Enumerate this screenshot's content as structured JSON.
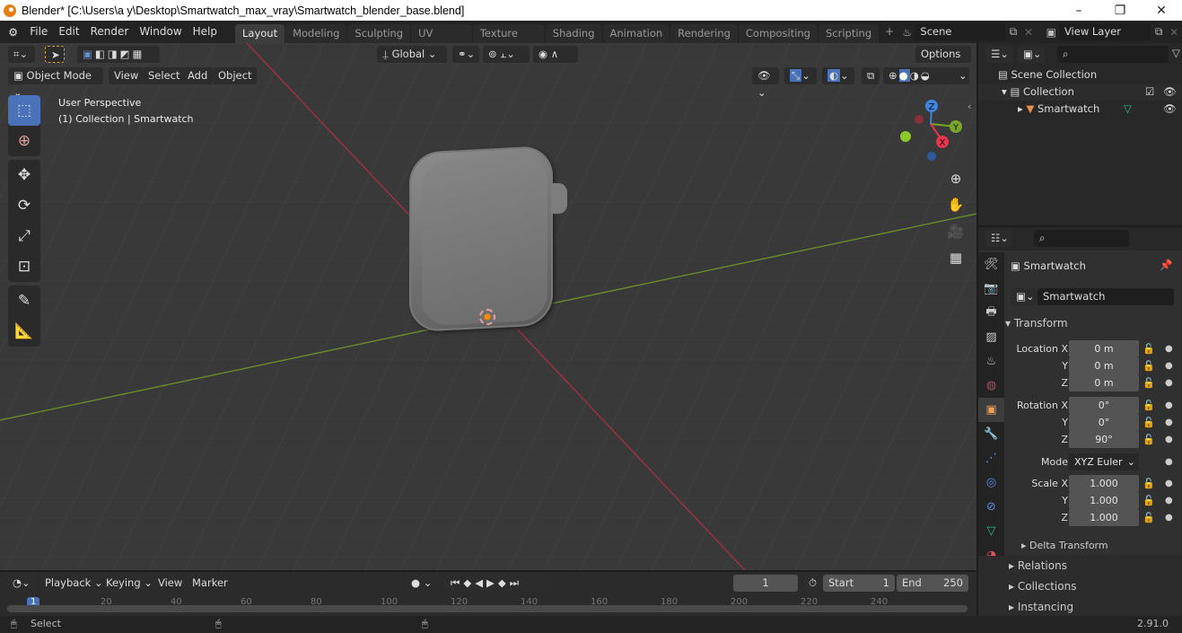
{
  "window": {
    "title": "Blender* [C:\\Users\\a y\\Desktop\\Smartwatch_max_vray\\Smartwatch_blender_base.blend]",
    "minimize": "–",
    "maximize": "❐",
    "close": "✕"
  },
  "menu": [
    "File",
    "Edit",
    "Render",
    "Window",
    "Help"
  ],
  "workspaces": [
    {
      "label": "Layout",
      "active": true
    },
    {
      "label": "Modeling"
    },
    {
      "label": "Sculpting"
    },
    {
      "label": "UV Editing"
    },
    {
      "label": "Texture Paint"
    },
    {
      "label": "Shading"
    },
    {
      "label": "Animation"
    },
    {
      "label": "Rendering"
    },
    {
      "label": "Compositing"
    },
    {
      "label": "Scripting"
    }
  ],
  "add_workspace": "+",
  "scene": {
    "value": "Scene"
  },
  "view_layer": {
    "value": "View Layer"
  },
  "viewport": {
    "orientation": "Global",
    "options": "Options",
    "mode": "Object Mode",
    "header_menus": [
      "View",
      "Select",
      "Add",
      "Object"
    ],
    "overlay_text": {
      "line1": "User Perspective",
      "line2": "(1) Collection | Smartwatch"
    },
    "gizmo_axes": {
      "x": "X",
      "y": "Y",
      "z": "Z",
      "x_color": "#e8344d",
      "y_color": "#7aa52b",
      "z_color": "#3d85de"
    }
  },
  "outliner": {
    "search_placeholder": "",
    "items": [
      {
        "label": "Scene Collection"
      },
      {
        "label": "Collection"
      },
      {
        "label": "Smartwatch"
      }
    ]
  },
  "properties": {
    "object_name": "Smartwatch",
    "data_name": "Smartwatch",
    "transform": {
      "title": "Transform",
      "location": {
        "label": "Location X",
        "x": "0 m",
        "y": "0 m",
        "z": "0 m"
      },
      "rotation": {
        "label": "Rotation X",
        "x": "0°",
        "y": "0°",
        "z": "90°"
      },
      "mode": {
        "label": "Mode",
        "value": "XYZ Euler"
      },
      "scale": {
        "label": "Scale X",
        "x": "1.000",
        "y": "1.000",
        "z": "1.000"
      },
      "axis_y": "Y",
      "axis_z": "Z"
    },
    "sections": [
      "Delta Transform",
      "Relations",
      "Collections",
      "Instancing"
    ]
  },
  "timeline": {
    "menus": [
      "Playback",
      "Keying",
      "View",
      "Marker"
    ],
    "current_frame": "1",
    "start_label": "Start",
    "start": "1",
    "end_label": "End",
    "end": "250",
    "ruler": [
      "1",
      "20",
      "40",
      "60",
      "80",
      "100",
      "120",
      "140",
      "160",
      "180",
      "200",
      "220",
      "240"
    ]
  },
  "status": {
    "select": "Select",
    "version": "2.91.0"
  }
}
